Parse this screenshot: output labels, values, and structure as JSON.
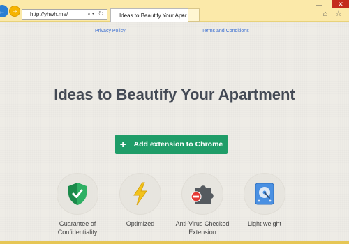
{
  "browser": {
    "url": "http://yhwh.me/",
    "tab_title": "Ideas to Beautify Your Apar...",
    "tab_close": "×",
    "back_icon": "←",
    "forward_icon": "→",
    "address_icons": "⌕▾ ↻",
    "window_icons": "⌂ ☆",
    "minimize": "—",
    "close": "✕"
  },
  "links": {
    "privacy": "Privacy Policy",
    "terms": "Terms and Conditions"
  },
  "headline": "Ideas to Beautify Your Apartment",
  "cta": {
    "plus": "+",
    "label": "Add extension to Chrome",
    "color": "#1f9d68"
  },
  "features": [
    {
      "icon": "shield-check-icon",
      "label_lines": [
        "Guarantee of",
        "Confidentiality"
      ]
    },
    {
      "icon": "lightning-icon",
      "label_lines": [
        "Optimized"
      ]
    },
    {
      "icon": "puzzle-block-icon",
      "label_lines": [
        "Anti-Virus Checked",
        "Extension"
      ]
    },
    {
      "icon": "hard-drive-icon",
      "label_lines": [
        "Light weight"
      ]
    }
  ]
}
